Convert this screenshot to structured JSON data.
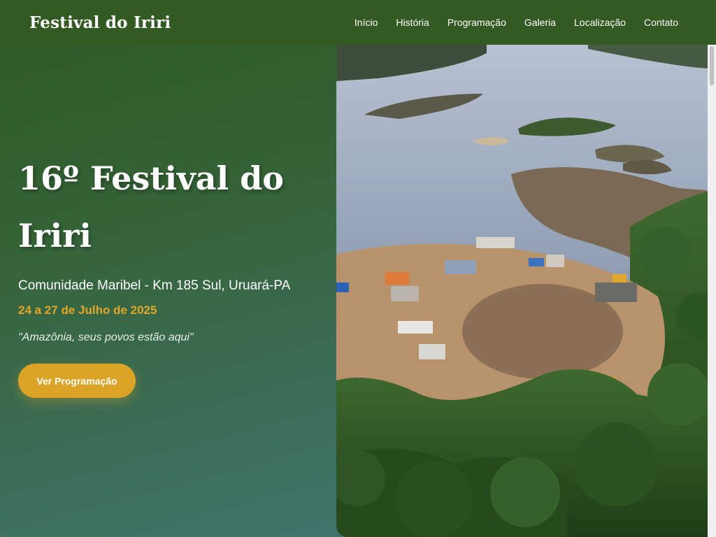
{
  "nav": {
    "brand": "Festival do Iriri",
    "links": [
      "Início",
      "História",
      "Programação",
      "Galeria",
      "Localização",
      "Contato"
    ]
  },
  "hero": {
    "title": "16º Festival do Iriri",
    "location": "Comunidade Maribel - Km 185 Sul, Uruará-PA",
    "dates": "24 a 27 de Julho de 2025",
    "quote": "\"Amazônia, seus povos estão aqui\"",
    "cta_label": "Ver Programação"
  },
  "colors": {
    "nav_bg": "#335a22",
    "accent": "#dba426",
    "hero_gradient_start": "#2f5b27",
    "hero_gradient_end": "#417b78"
  }
}
